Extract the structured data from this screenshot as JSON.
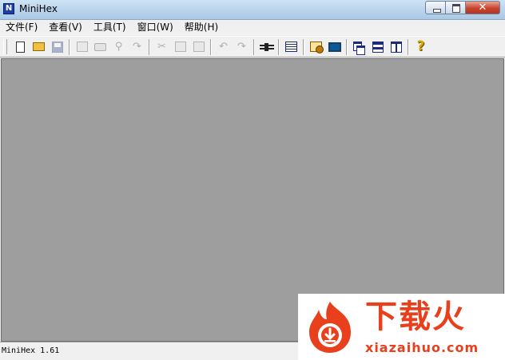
{
  "window": {
    "title": "MiniHex",
    "app_icon_letter": "N"
  },
  "menu": [
    {
      "label": "文件(F)"
    },
    {
      "label": "查看(V)"
    },
    {
      "label": "工具(T)"
    },
    {
      "label": "窗口(W)"
    },
    {
      "label": "帮助(H)"
    }
  ],
  "toolbar": {
    "icons": [
      "new-file-icon",
      "open-folder-icon",
      "save-icon",
      "properties-icon",
      "print-icon",
      "find-icon",
      "goto-icon",
      "cut-icon",
      "copy-icon",
      "paste-icon",
      "undo-icon",
      "redo-icon",
      "pin-icon",
      "table-icon",
      "settings-icon",
      "monitor-icon",
      "cascade-icon",
      "tile-horizontal-icon",
      "tile-vertical-icon",
      "help-icon"
    ],
    "help_glyph": "?",
    "cut_glyph": "✂",
    "find_glyph": "⚲",
    "undo_glyph": "↶",
    "redo_glyph": "↷",
    "goto_glyph": "↷"
  },
  "statusbar": {
    "text": "MiniHex 1.61"
  },
  "watermark": {
    "brand": "下载火",
    "url": "xiazaihuo.com",
    "accent_color": "#e8401c"
  },
  "colors": {
    "mdi_background": "#9e9e9e",
    "chrome": "#f0f0f0"
  }
}
